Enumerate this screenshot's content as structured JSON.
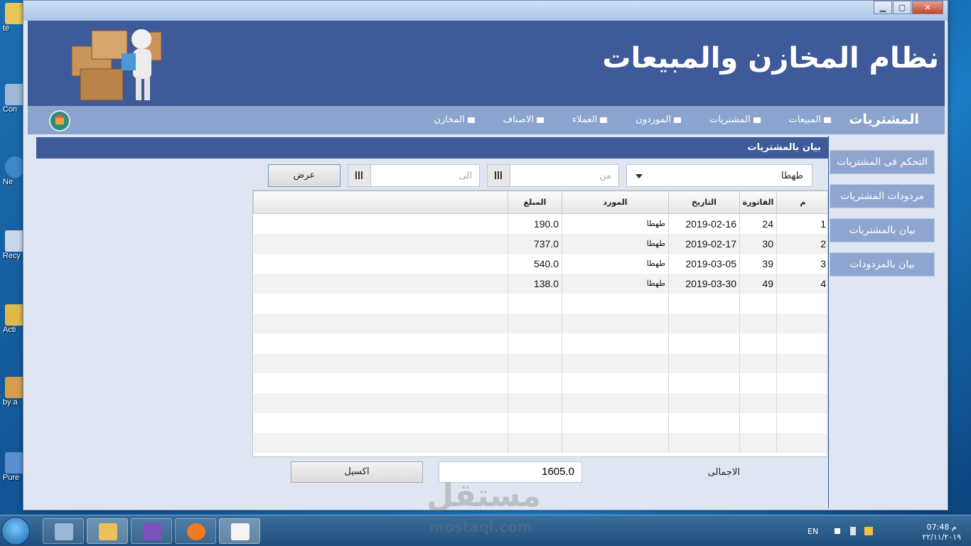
{
  "desktop": {
    "icons": [
      {
        "label": "te"
      },
      {
        "label": "Con"
      },
      {
        "label": "Ne"
      },
      {
        "label": "Recy"
      },
      {
        "label": "Acti"
      },
      {
        "label": "by a"
      },
      {
        "label": "Pure"
      }
    ]
  },
  "window": {
    "minimize": "▁",
    "maximize": "▢",
    "close": "✕"
  },
  "header": {
    "app_title": "نظام المخازن والمبيعات"
  },
  "nav": {
    "title": "المشتريات",
    "items": [
      {
        "label": "المخازن"
      },
      {
        "label": "الاصناف"
      },
      {
        "label": "العملاء"
      },
      {
        "label": "الموردون"
      },
      {
        "label": "المشتريات"
      },
      {
        "label": "المبيعات"
      }
    ]
  },
  "sidebar": {
    "buttons": [
      {
        "label": "التحكم فى المشتريات"
      },
      {
        "label": "مردودات المشتريات"
      },
      {
        "label": "بيان بالمشتريات"
      },
      {
        "label": "بيان بالمردودات"
      }
    ]
  },
  "content": {
    "header": "بيان بالمشتريات",
    "supplier_select": "طهطا",
    "from_placeholder": "من",
    "to_placeholder": "الى",
    "show_button": "عرض",
    "table": {
      "columns": [
        "م",
        "الفاتورة",
        "التاريخ",
        "المورد",
        "المبلغ"
      ],
      "rows": [
        {
          "idx": "1",
          "invoice": "24",
          "date": "2019-02-16",
          "supplier": "طهطا",
          "amount": "190.0"
        },
        {
          "idx": "2",
          "invoice": "30",
          "date": "2019-02-17",
          "supplier": "طهطا",
          "amount": "737.0"
        },
        {
          "idx": "3",
          "invoice": "39",
          "date": "2019-03-05",
          "supplier": "طهطا",
          "amount": "540.0"
        },
        {
          "idx": "4",
          "invoice": "49",
          "date": "2019-03-30",
          "supplier": "طهطا",
          "amount": "138.0"
        }
      ]
    },
    "total_label": "الاجمالى",
    "total_value": "1605.0",
    "excel_button": "اكسيل"
  },
  "watermark": {
    "main": "مستقل",
    "sub": "mostaql.com"
  },
  "taskbar": {
    "lang": "EN",
    "time": "07:48 م",
    "date": "٢٢/١١/٢٠١٩"
  }
}
